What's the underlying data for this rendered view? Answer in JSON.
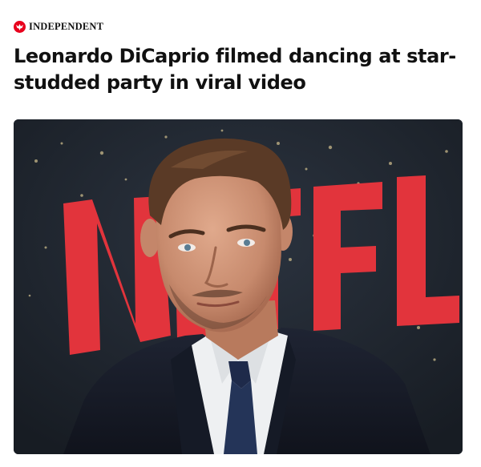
{
  "source": {
    "name": "INDEPENDENT",
    "logo_icon": "eagle-icon",
    "logo_color": "#e8001c"
  },
  "article": {
    "headline": "Leonardo DiCaprio filmed dancing at star-studded party in viral video"
  },
  "photo": {
    "backdrop_text": "NETFL",
    "backdrop_color": "#232a33",
    "backdrop_text_color": "#e2343c"
  }
}
